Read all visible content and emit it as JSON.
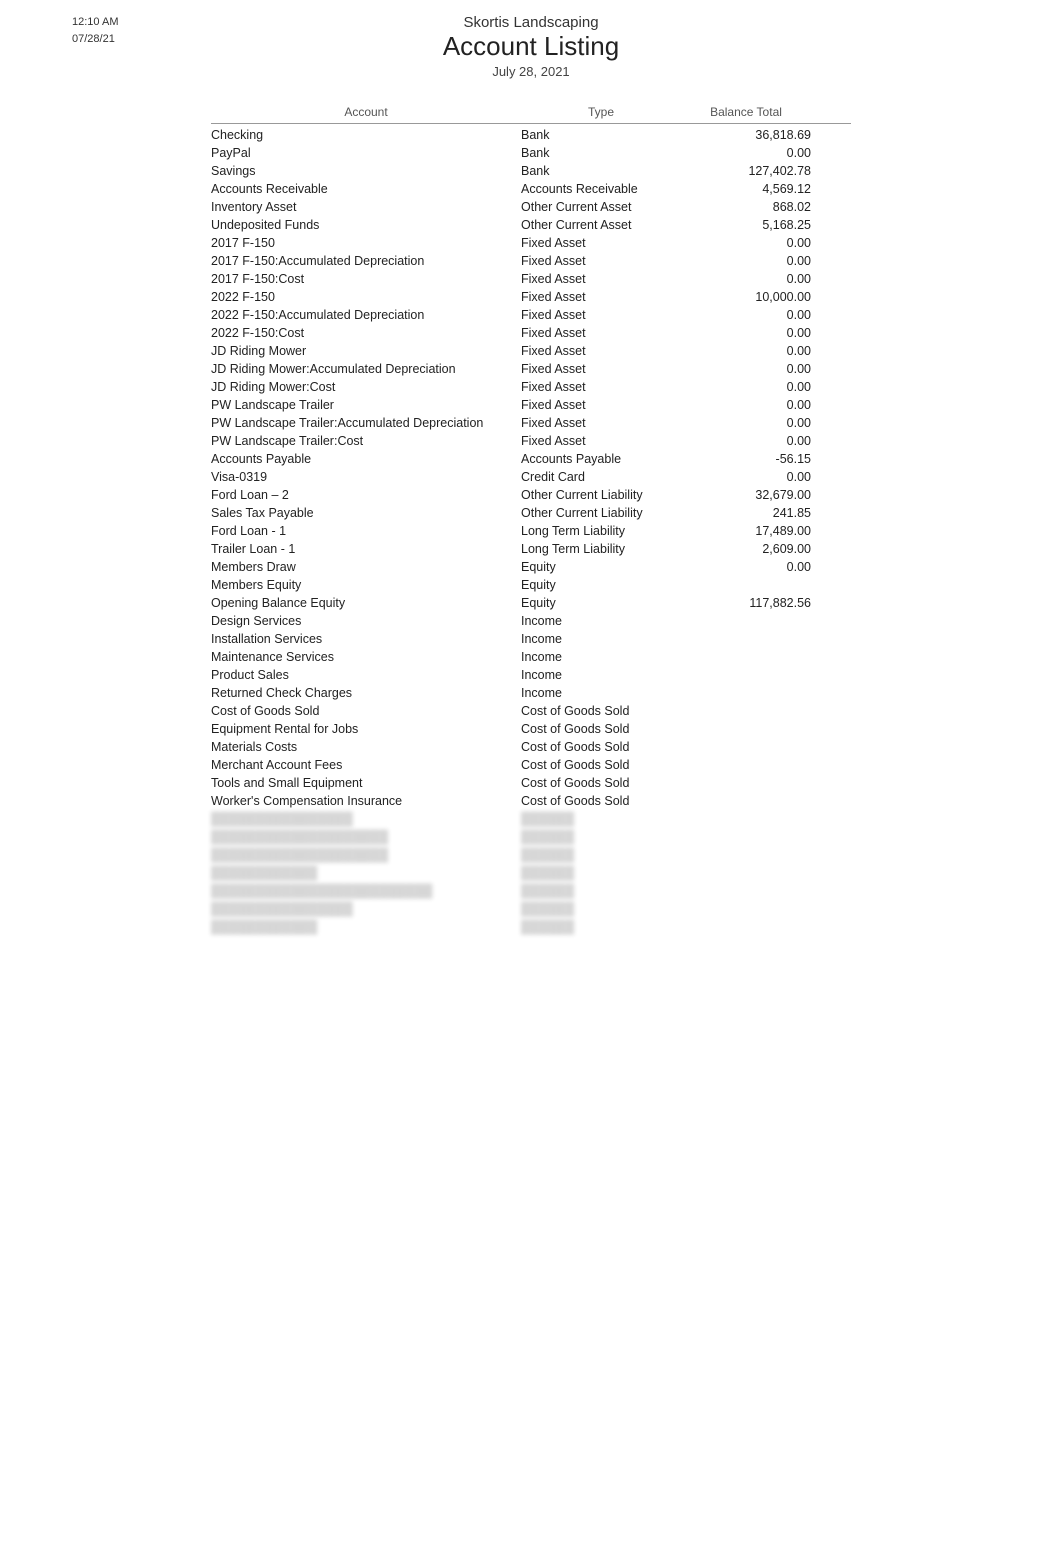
{
  "timestamp": {
    "time": "12:10 AM",
    "date": "07/28/21"
  },
  "header": {
    "company": "Skortis Landscaping",
    "title": "Account Listing",
    "date": "July 28, 2021"
  },
  "columns": {
    "account": "Account",
    "type": "Type",
    "balance": "Balance Total"
  },
  "rows": [
    {
      "account": "Checking",
      "type": "Bank",
      "balance": "36,818.69"
    },
    {
      "account": "PayPal",
      "type": "Bank",
      "balance": "0.00"
    },
    {
      "account": "Savings",
      "type": "Bank",
      "balance": "127,402.78"
    },
    {
      "account": "Accounts Receivable",
      "type": "Accounts Receivable",
      "balance": "4,569.12"
    },
    {
      "account": "Inventory Asset",
      "type": "Other Current Asset",
      "balance": "868.02"
    },
    {
      "account": "Undeposited Funds",
      "type": "Other Current Asset",
      "balance": "5,168.25"
    },
    {
      "account": "2017 F-150",
      "type": "Fixed Asset",
      "balance": "0.00"
    },
    {
      "account": "2017 F-150:Accumulated Depreciation",
      "type": "Fixed Asset",
      "balance": "0.00"
    },
    {
      "account": "2017 F-150:Cost",
      "type": "Fixed Asset",
      "balance": "0.00"
    },
    {
      "account": "2022 F-150",
      "type": "Fixed Asset",
      "balance": "10,000.00"
    },
    {
      "account": "2022 F-150:Accumulated Depreciation",
      "type": "Fixed Asset",
      "balance": "0.00"
    },
    {
      "account": "2022 F-150:Cost",
      "type": "Fixed Asset",
      "balance": "0.00"
    },
    {
      "account": "JD Riding Mower",
      "type": "Fixed Asset",
      "balance": "0.00"
    },
    {
      "account": "JD Riding Mower:Accumulated Depreciation",
      "type": "Fixed Asset",
      "balance": "0.00"
    },
    {
      "account": "JD Riding Mower:Cost",
      "type": "Fixed Asset",
      "balance": "0.00"
    },
    {
      "account": "PW Landscape Trailer",
      "type": "Fixed Asset",
      "balance": "0.00"
    },
    {
      "account": "PW Landscape Trailer:Accumulated Depreciation",
      "type": "Fixed Asset",
      "balance": "0.00"
    },
    {
      "account": "PW Landscape Trailer:Cost",
      "type": "Fixed Asset",
      "balance": "0.00"
    },
    {
      "account": "Accounts Payable",
      "type": "Accounts Payable",
      "balance": "-56.15"
    },
    {
      "account": "Visa-0319",
      "type": "Credit Card",
      "balance": "0.00"
    },
    {
      "account": "Ford Loan – 2",
      "type": "Other Current Liability",
      "balance": "32,679.00"
    },
    {
      "account": "Sales Tax Payable",
      "type": "Other Current Liability",
      "balance": "241.85"
    },
    {
      "account": "Ford Loan - 1",
      "type": "Long Term Liability",
      "balance": "17,489.00"
    },
    {
      "account": "Trailer Loan - 1",
      "type": "Long Term Liability",
      "balance": "2,609.00"
    },
    {
      "account": "Members Draw",
      "type": "Equity",
      "balance": "0.00"
    },
    {
      "account": "Members Equity",
      "type": "Equity",
      "balance": ""
    },
    {
      "account": "Opening Balance Equity",
      "type": "Equity",
      "balance": "117,882.56"
    },
    {
      "account": "Design Services",
      "type": "Income",
      "balance": ""
    },
    {
      "account": "Installation Services",
      "type": "Income",
      "balance": ""
    },
    {
      "account": "Maintenance Services",
      "type": "Income",
      "balance": ""
    },
    {
      "account": "Product Sales",
      "type": "Income",
      "balance": ""
    },
    {
      "account": "Returned Check Charges",
      "type": "Income",
      "balance": ""
    },
    {
      "account": "Cost of Goods Sold",
      "type": "Cost of Goods Sold",
      "balance": ""
    },
    {
      "account": "Equipment Rental for Jobs",
      "type": "Cost of Goods Sold",
      "balance": ""
    },
    {
      "account": "Materials Costs",
      "type": "Cost of Goods Sold",
      "balance": ""
    },
    {
      "account": "Merchant Account Fees",
      "type": "Cost of Goods Sold",
      "balance": ""
    },
    {
      "account": "Tools and Small Equipment",
      "type": "Cost of Goods Sold",
      "balance": ""
    },
    {
      "account": "Worker's Compensation Insurance",
      "type": "Cost of Goods Sold",
      "balance": ""
    }
  ],
  "blurred_rows": [
    {
      "account": "████████████████",
      "type": "██████",
      "balance": ""
    },
    {
      "account": "████████████████████",
      "type": "██████",
      "balance": ""
    },
    {
      "account": "████████████████████",
      "type": "██████",
      "balance": ""
    },
    {
      "account": "████████████",
      "type": "██████",
      "balance": ""
    },
    {
      "account": "█████████████████████████",
      "type": "██████",
      "balance": ""
    },
    {
      "account": "████████████████",
      "type": "██████",
      "balance": ""
    },
    {
      "account": "████████████",
      "type": "██████",
      "balance": ""
    }
  ]
}
